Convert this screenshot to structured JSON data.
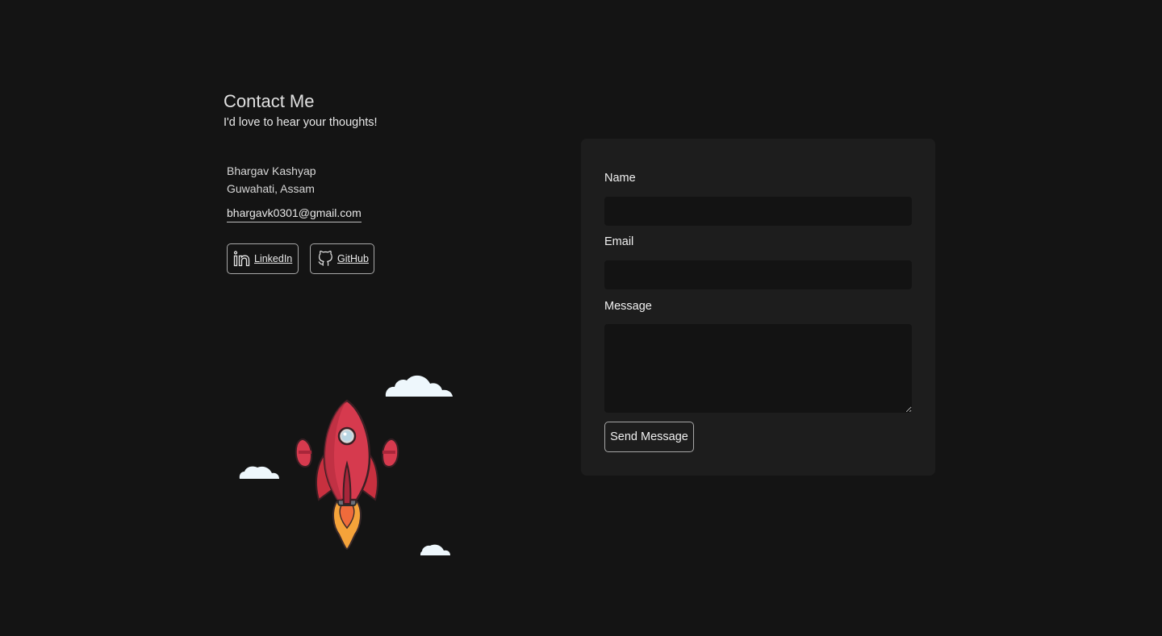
{
  "contact": {
    "title": "Contact Me",
    "subtitle": "I'd love to hear your thoughts!",
    "name": "Bhargav Kashyap",
    "location": "Guwahati, Assam",
    "email": "bhargavk0301@gmail.com"
  },
  "social": {
    "linkedin": {
      "label": "LinkedIn",
      "icon": "linkedin-icon"
    },
    "github": {
      "label": "GitHub",
      "icon": "github-icon"
    }
  },
  "form": {
    "name_label": "Name",
    "name_value": "",
    "email_label": "Email",
    "email_value": "",
    "message_label": "Message",
    "message_value": "",
    "submit_label": "Send Message"
  },
  "colors": {
    "background": "#141414",
    "card": "#1d1d1d",
    "input": "#131313",
    "rocket_body": "#d63a4e",
    "flame": "#f5a33a",
    "cloud": "#eef7fc"
  }
}
